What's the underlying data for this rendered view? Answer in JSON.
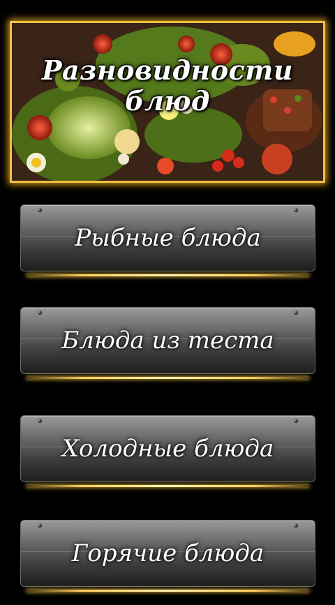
{
  "header": {
    "title": "Разновидности\nблюд"
  },
  "menu": {
    "items": [
      {
        "label": "Рыбные блюда"
      },
      {
        "label": "Блюда из теста"
      },
      {
        "label": "Холодные блюда"
      },
      {
        "label": "Горячие блюда"
      }
    ]
  },
  "colors": {
    "background": "#000000",
    "frame_glow": "#f0c040",
    "button_top": "#9a9a9a",
    "button_bottom": "#1e1e1e",
    "accent_line": "#ffd060",
    "text": "#ffffff"
  }
}
